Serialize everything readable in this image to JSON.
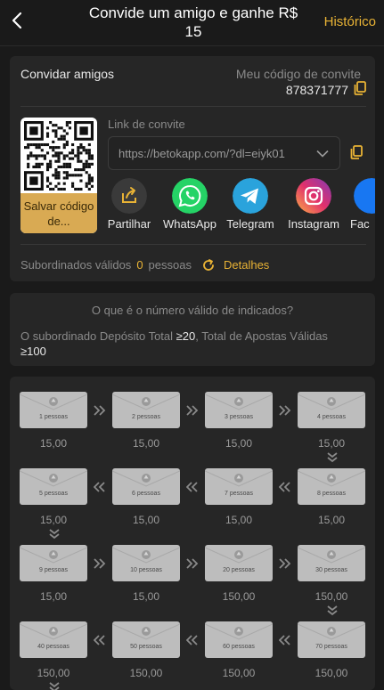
{
  "header": {
    "title": "Convide um amigo e ganhe R$ 15",
    "history_link": "Histórico"
  },
  "invite": {
    "label": "Convidar amigos",
    "code_label": "Meu código de convite",
    "code_value": "878371777",
    "link_label": "Link de convite",
    "link_value": "https://betokapp.com/?dl=eiyk01",
    "qr_save": "Salvar código de..."
  },
  "share": [
    {
      "label": "Partilhar",
      "icon": "share-icon",
      "color": "#3a3a3a"
    },
    {
      "label": "WhatsApp",
      "icon": "whatsapp-icon",
      "color": "#25d366"
    },
    {
      "label": "Telegram",
      "icon": "telegram-icon",
      "color": "#2aa3dc"
    },
    {
      "label": "Instagram",
      "icon": "instagram-icon",
      "color": "#d6306c"
    },
    {
      "label": "Fac",
      "icon": "facebook-icon",
      "color": "#1877f2"
    }
  ],
  "subordinates": {
    "label": "Subordinados válidos",
    "count": "0",
    "unit": "pessoas",
    "details": "Detalhes"
  },
  "rules": {
    "question": "O que é o número válido de indicados?",
    "p1": "O subordinado Depósito Total",
    "v1": "≥20",
    "p2": ",  Total de Apostas Válidas",
    "v2": "≥100"
  },
  "tiers": [
    {
      "people": "1 pessoas",
      "amount": "15,00"
    },
    {
      "people": "2 pessoas",
      "amount": "15,00"
    },
    {
      "people": "3 pessoas",
      "amount": "15,00"
    },
    {
      "people": "4 pessoas",
      "amount": "15,00"
    },
    {
      "people": "8 pessoas",
      "amount": "15,00"
    },
    {
      "people": "7 pessoas",
      "amount": "15,00"
    },
    {
      "people": "6 pessoas",
      "amount": "15,00"
    },
    {
      "people": "5 pessoas",
      "amount": "15,00"
    },
    {
      "people": "9 pessoas",
      "amount": "15,00"
    },
    {
      "people": "10 pessoas",
      "amount": "15,00"
    },
    {
      "people": "20 pessoas",
      "amount": "150,00"
    },
    {
      "people": "30 pessoas",
      "amount": "150,00"
    },
    {
      "people": "70 pessoas",
      "amount": "150,00"
    },
    {
      "people": "60 pessoas",
      "amount": "150,00"
    },
    {
      "people": "50 pessoas",
      "amount": "150,00"
    },
    {
      "people": "40 pessoas",
      "amount": "150,00"
    }
  ],
  "colors": {
    "accent": "#e9b335",
    "card": "#262626",
    "background": "#1a1a1a"
  }
}
